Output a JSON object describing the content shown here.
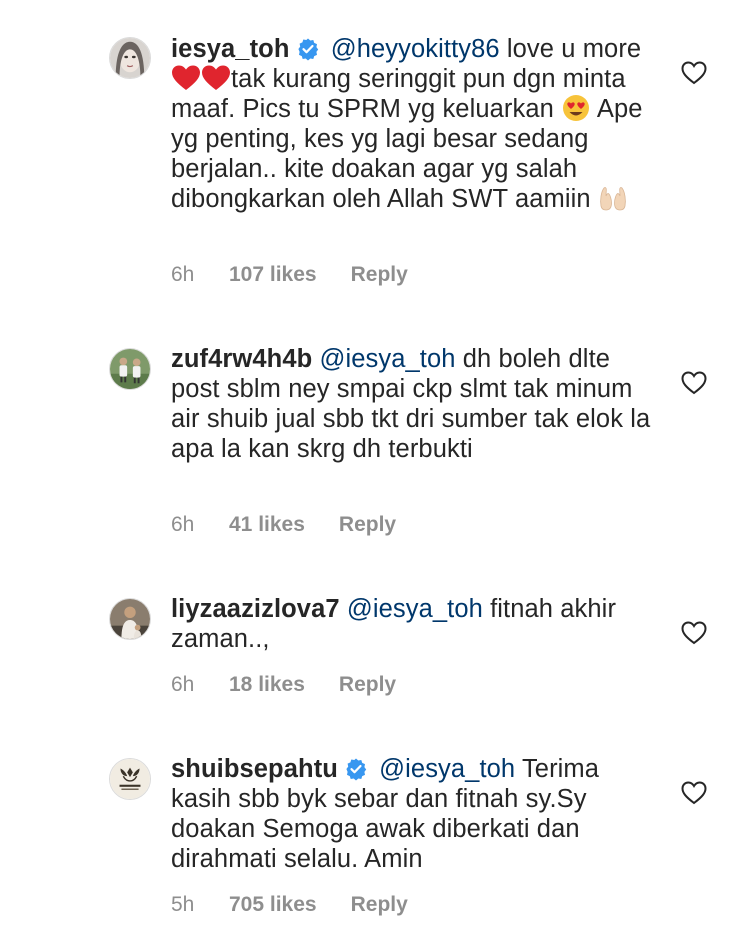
{
  "comments": [
    {
      "username": "iesya_toh",
      "verified": true,
      "mention": "@heyyokitty86",
      "text_before_emoji1": "love u more",
      "text_after_emoji1": "tak kurang seringgit pun dgn minta maaf. Pics tu SPRM yg keluarkan",
      "text_after_emoji2": "Ape yg penting, kes yg lagi besar sedang berjalan.. kite doakan agar yg salah dibongkarkan oleh Allah SWT aamiin",
      "emojis": [
        "red-heart",
        "red-heart",
        "heart-eyes-face",
        "palms-up-together"
      ],
      "time": "6h",
      "likes": "107 likes",
      "reply": "Reply"
    },
    {
      "username": "zuf4rw4h4b",
      "verified": false,
      "mention": "@iesya_toh",
      "text": "dh boleh dlte post sblm ney smpai ckp slmt tak minum air shuib jual sbb tkt dri sumber tak elok la apa la kan skrg dh terbukti",
      "time": "6h",
      "likes": "41 likes",
      "reply": "Reply"
    },
    {
      "username": "liyzaazizlova7",
      "verified": false,
      "mention": "@iesya_toh",
      "text": "fitnah akhir zaman..,",
      "time": "6h",
      "likes": "18 likes",
      "reply": "Reply"
    },
    {
      "username": "shuibsepahtu",
      "verified": true,
      "mention": "@iesya_toh",
      "text": "Terima kasih sbb byk sebar dan fitnah sy.Sy doakan Semoga awak diberkati dan dirahmati selalu. Amin",
      "time": "5h",
      "likes": "705 likes",
      "reply": "Reply"
    }
  ],
  "colors": {
    "text": "#262626",
    "mention": "#00376b",
    "meta": "#8e8e8e",
    "verified": "#3897f0",
    "heart_outline": "#262626"
  },
  "icons": [
    "heart-outline-icon",
    "verified-badge-icon"
  ]
}
